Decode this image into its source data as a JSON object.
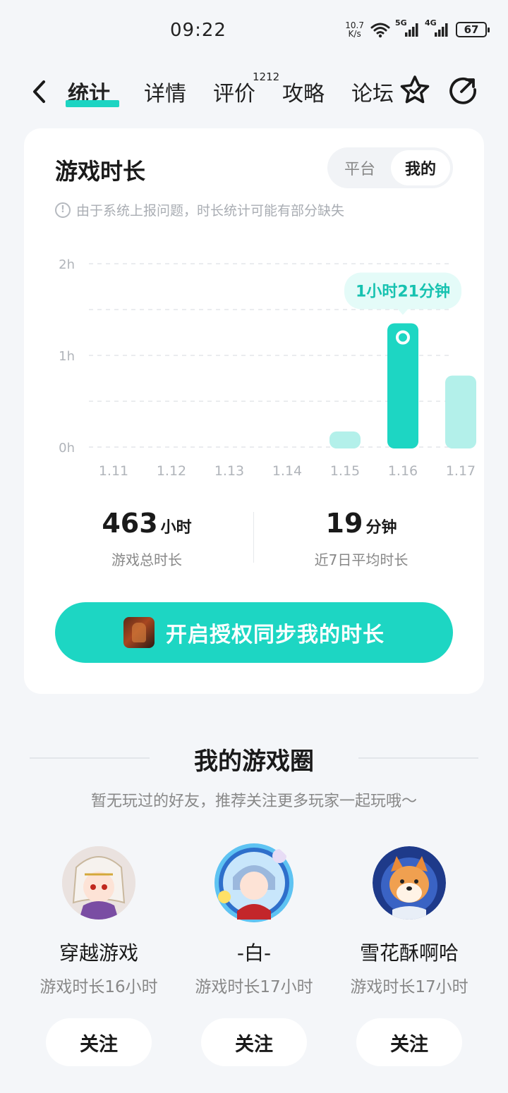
{
  "status_bar": {
    "time": "09:22",
    "net_speed_value": "10.7",
    "net_speed_unit": "K/s",
    "sim1": "5G",
    "sim2": "4G",
    "battery": "67"
  },
  "nav": {
    "tabs": [
      {
        "label": "统计",
        "active": true
      },
      {
        "label": "详情",
        "active": false
      },
      {
        "label": "评价",
        "active": false
      },
      {
        "label": "攻略",
        "active": false
      },
      {
        "label": "论坛",
        "active": false
      }
    ],
    "review_count": "1212",
    "icons": [
      "back-icon",
      "favorite-star-icon",
      "share-icon"
    ]
  },
  "stats_card": {
    "title": "游戏时长",
    "segment": {
      "options": [
        "平台",
        "我的"
      ],
      "selected": "我的"
    },
    "notice": "由于系统上报问题，时长统计可能有部分缺失",
    "total": {
      "value": "463",
      "unit": "小时",
      "label": "游戏总时长"
    },
    "average": {
      "value": "19",
      "unit": "分钟",
      "label": "近7日平均时长"
    },
    "sync_button": "开启授权同步我的时长"
  },
  "chart_data": {
    "type": "bar",
    "categories": [
      "1.11",
      "1.12",
      "1.13",
      "1.14",
      "1.15",
      "1.16",
      "1.17"
    ],
    "values_hours": [
      0,
      0,
      0,
      0,
      0.17,
      1.35,
      0.78
    ],
    "y_ticks": [
      "2h",
      "1h",
      "0h"
    ],
    "ylim": [
      0,
      2
    ],
    "selected_index": 5,
    "tooltip": "1小时21分钟",
    "colors": {
      "selected": "#1dd6c3",
      "normal": "#b3f0ea",
      "tooltip_text": "#17c2b0"
    }
  },
  "game_circle": {
    "title": "我的游戏圈",
    "subtitle": "暂无玩过的好友，推荐关注更多玩家一起玩哦～",
    "users": [
      {
        "name": "穿越游戏",
        "meta": "游戏时长16小时",
        "follow": "关注"
      },
      {
        "name": "-白-",
        "meta": "游戏时长17小时",
        "follow": "关注"
      },
      {
        "name": "雪花酥啊哈",
        "meta": "游戏时长17小时",
        "follow": "关注"
      }
    ]
  },
  "colors": {
    "accent": "#1dd6c3",
    "background": "#f4f6f9"
  }
}
